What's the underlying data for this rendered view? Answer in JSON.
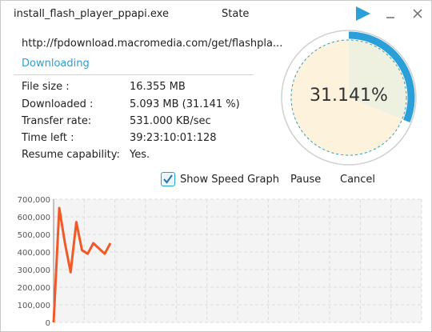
{
  "title": {
    "filename": "install_flash_player_ppapi.exe",
    "state_label": "State"
  },
  "icons": {
    "play": "play-icon",
    "minimize": "minimize-icon",
    "close": "close-icon",
    "checkbox": "checkmark-icon"
  },
  "colors": {
    "accent": "#2a9fd8",
    "progress_fill": "#fdf3dc",
    "chart_line": "#f05a28",
    "chart_bg": "#f4f4f4"
  },
  "download": {
    "url": "http://fpdownload.macromedia.com/get/flashpla...",
    "status": "Downloading",
    "progress_percent": 31.141,
    "progress_label": "31.141%",
    "rows": [
      {
        "label": "File size :",
        "value": "16.355 MB"
      },
      {
        "label": "Downloaded :",
        "value": "5.093 MB (31.141 %)"
      },
      {
        "label": "Transfer rate:",
        "value": "531.000 KB/sec"
      },
      {
        "label": "Time left :",
        "value": "39:23:10:01:128"
      },
      {
        "label": "Resume capability:",
        "value": "Yes."
      }
    ]
  },
  "controls": {
    "show_speed_graph": "Show Speed Graph",
    "show_speed_graph_checked": true,
    "pause": "Pause",
    "cancel": "Cancel"
  },
  "chart_data": {
    "type": "line",
    "title": "",
    "xlabel": "",
    "ylabel": "",
    "ylim": [
      0,
      700000
    ],
    "yticks": [
      "0",
      "100,000",
      "200,000",
      "300,000",
      "400,000",
      "500,000",
      "600,000",
      "700,000"
    ],
    "grid": true,
    "series": [
      {
        "values": [
          0,
          650000,
          450000,
          285000,
          570000,
          410000,
          390000,
          450000,
          420000,
          390000,
          450000
        ]
      }
    ]
  }
}
